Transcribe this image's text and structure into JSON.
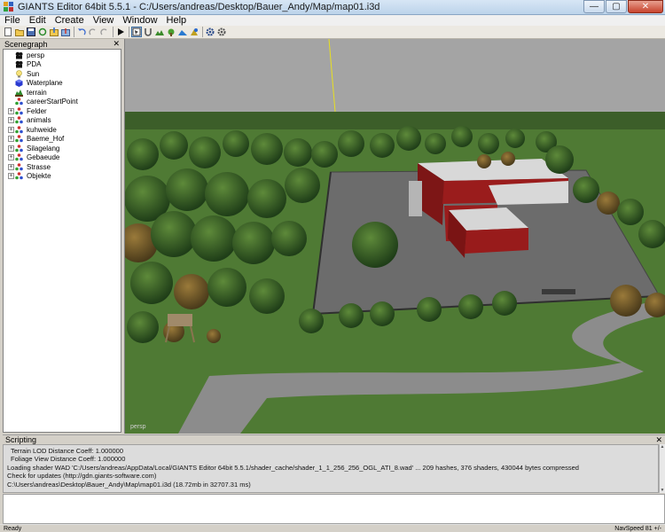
{
  "window": {
    "title": "GIANTS Editor 64bit 5.5.1 - C:/Users/andreas/Desktop/Bauer_Andy/Map/map01.i3d",
    "minimize_glyph": "—",
    "maximize_glyph": "▢",
    "close_glyph": "✕"
  },
  "menu": [
    {
      "label": "File"
    },
    {
      "label": "Edit"
    },
    {
      "label": "Create"
    },
    {
      "label": "View"
    },
    {
      "label": "Window"
    },
    {
      "label": "Help"
    }
  ],
  "toolbar": {
    "buttons": [
      "new-icon",
      "open-icon",
      "save-icon",
      "reload-icon",
      "import-icon",
      "export-icon",
      "undo-icon",
      "redo-icon",
      "play-icon",
      "select-icon",
      "magnet-icon",
      "terrain-paint-icon",
      "foliage-paint-icon",
      "terrain-sculpt-icon",
      "texture-paint-icon",
      "settings-icon",
      "settings-alt-icon"
    ]
  },
  "scenegraph": {
    "title": "Scenegraph",
    "close_glyph": "✕",
    "nodes": [
      {
        "label": "persp",
        "type": "camera",
        "expandable": false
      },
      {
        "label": "PDA",
        "type": "camera",
        "expandable": false
      },
      {
        "label": "Sun",
        "type": "light",
        "expandable": false
      },
      {
        "label": "Waterplane",
        "type": "shape",
        "expandable": false
      },
      {
        "label": "terrain",
        "type": "terrain",
        "expandable": false
      },
      {
        "label": "careerStartPoint",
        "type": "transform",
        "expandable": false
      },
      {
        "label": "Felder",
        "type": "transform",
        "expandable": true
      },
      {
        "label": "animals",
        "type": "transform",
        "expandable": true
      },
      {
        "label": "kuhweide",
        "type": "transform",
        "expandable": true
      },
      {
        "label": "Baeme_Hof",
        "type": "transform",
        "expandable": true
      },
      {
        "label": "Silagelang",
        "type": "transform",
        "expandable": true
      },
      {
        "label": "Gebaeude",
        "type": "transform",
        "expandable": true
      },
      {
        "label": "Strasse",
        "type": "transform",
        "expandable": true
      },
      {
        "label": "Objekte",
        "type": "transform",
        "expandable": true
      }
    ],
    "expander_glyph": "+"
  },
  "viewport": {
    "camera_label": "persp",
    "colors": {
      "sky": "#a2a2a2",
      "ground": "#4f7a34",
      "yard": "#6e6e6e",
      "roof": "#d8d8d8",
      "wall": "#8e1a1a",
      "road": "#8a8a8a"
    }
  },
  "scripting": {
    "title": "Scripting",
    "close_glyph": "✕",
    "log_lines": [
      "Terrain LOD Distance Coeff: 1.000000",
      "Foliage View Distance Coeff: 1.000000",
      "Loading shader WAD 'C:/Users/andreas/AppData/Local/GIANTS Editor 64bit 5.5.1/shader_cache/shader_1_1_256_256_OGL_ATI_8.wad' ... 209 hashes, 376 shaders, 430044 bytes compressed",
      "Check for updates (http://gdn.giants-software.com)",
      "C:\\Users\\andreas\\Desktop\\Bauer_Andy\\Map\\map01.i3d (18.72mb in 32707.31 ms)"
    ]
  },
  "statusbar": {
    "left": "Ready",
    "right": "NavSpeed 81 +/-"
  }
}
